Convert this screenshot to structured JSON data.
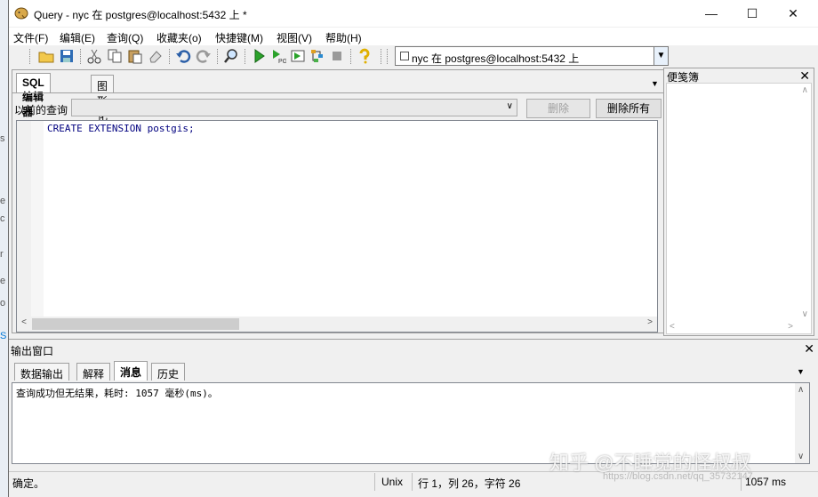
{
  "window": {
    "title": "Query - nyc 在  postgres@localhost:5432 上 *",
    "minimize": "—",
    "maximize": "☐",
    "close": "✕"
  },
  "menu": [
    "文件(F)",
    "编辑(E)",
    "查询(Q)",
    "收藏夹(o)",
    "快捷键(M)",
    "视图(V)",
    "帮助(H)"
  ],
  "toolbar": {
    "icons": [
      "open-folder-icon",
      "save-icon",
      "cut-icon",
      "copy-icon",
      "paste-icon",
      "eraser-icon",
      "undo-icon",
      "redo-icon",
      "find-icon",
      "execute-icon",
      "explain-icon",
      "execute-pgscript-icon",
      "explain-analyze-icon",
      "stop-icon",
      "help-icon"
    ],
    "connection": "nyc 在  postgres@localhost:5432 上"
  },
  "editor_tabs": [
    "SQL编辑器",
    "图形化查询构造器"
  ],
  "previous_query": {
    "label": "以前的查询",
    "delete": "删除",
    "delete_all": "删除所有"
  },
  "sql": "CREATE EXTENSION postgis;",
  "scratchpad": {
    "title": "便笺簿"
  },
  "output": {
    "title": "输出窗口",
    "tabs": [
      "数据输出",
      "解释",
      "消息",
      "历史"
    ],
    "active_tab": "消息",
    "message": "查询成功但无结果，耗时: 1057 毫秒(ms)。"
  },
  "status": {
    "state": "确定。",
    "encoding": "Unix",
    "position": "行 1，列 26，字符 26",
    "time": "1057 ms"
  },
  "watermark": {
    "text": "知乎 @不睡觉的怪叔叔",
    "url": "https://blog.csdn.net/qq_35732147"
  },
  "colors": {
    "sql_keyword": "#00007f",
    "accent": "#0078d7"
  }
}
